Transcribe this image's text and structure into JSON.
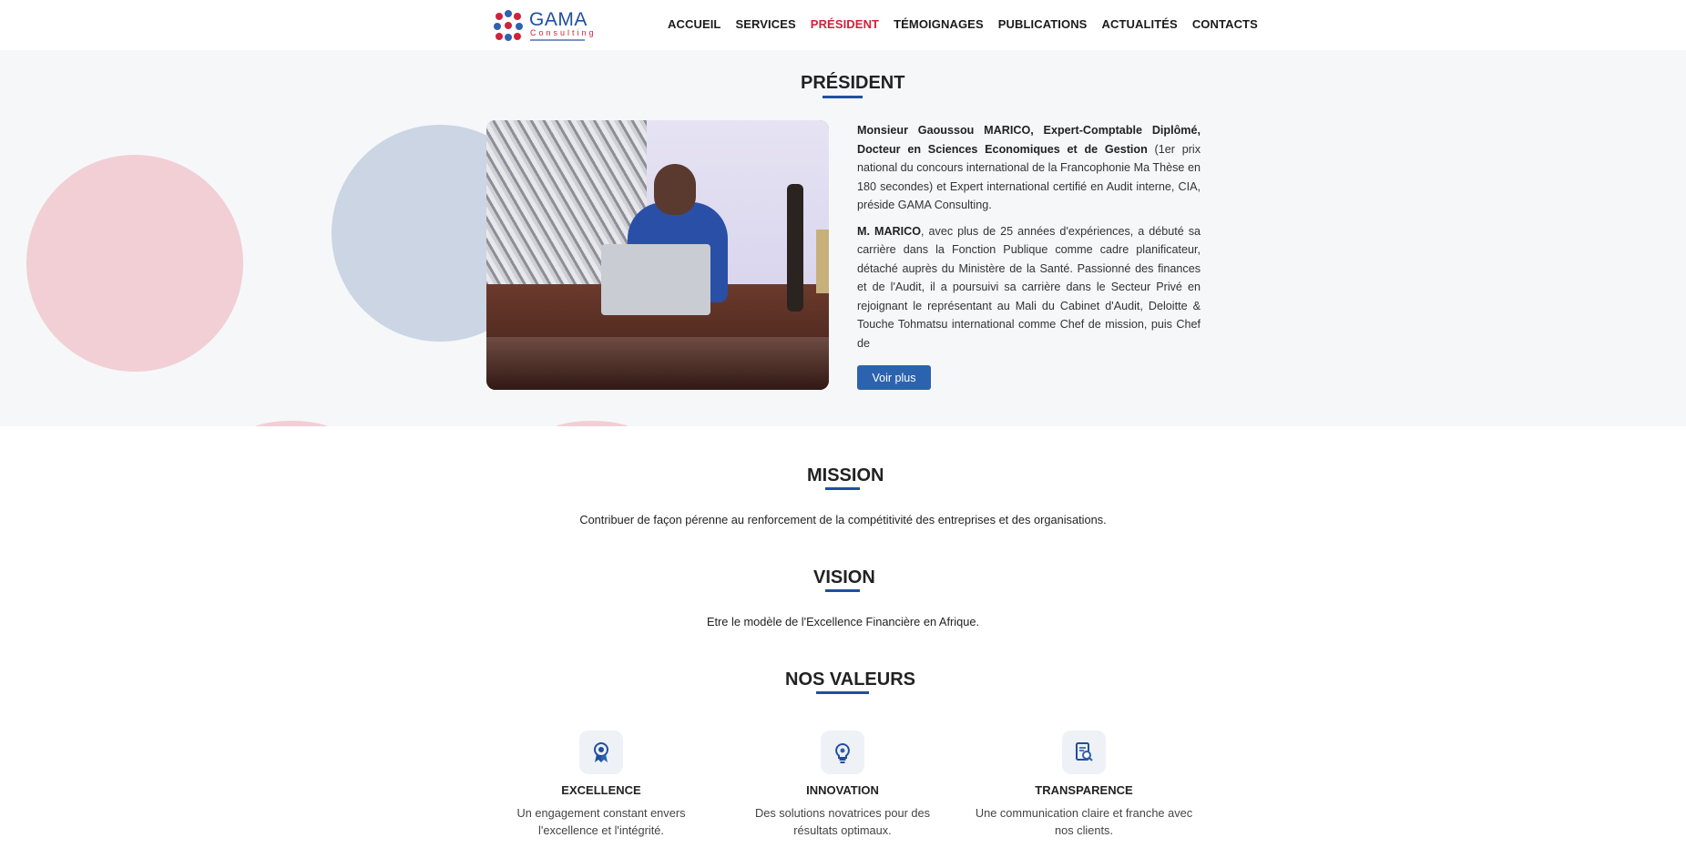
{
  "logo": {
    "brand": "GAMA",
    "sub": "Consulting"
  },
  "nav": {
    "items": [
      "ACCUEIL",
      "SERVICES",
      "PRÉSIDENT",
      "TÉMOIGNAGES",
      "PUBLICATIONS",
      "ACTUALITÉS",
      "CONTACTS"
    ],
    "active": "PRÉSIDENT"
  },
  "president": {
    "title": "PRÉSIDENT",
    "para1_bold": "Monsieur Gaoussou MARICO, Expert-Comptable Diplômé, Docteur en Sciences Economiques et de Gestion",
    "para1_rest": " (1er prix national du concours international de la Francophonie Ma Thèse en 180 secondes) et Expert international certifié en Audit interne, CIA, préside GAMA Consulting.",
    "para2_bold": "M. MARICO",
    "para2_rest": ", avec plus de 25 années d'expériences, a débuté sa carrière dans la Fonction Publique comme cadre planificateur, détaché auprès du Ministère de la Santé. Passionné des finances et de l'Audit, il a poursuivi sa carrière dans le Secteur Privé en rejoignant le représentant au Mali du Cabinet d'Audit, Deloitte & Touche Tohmatsu international comme Chef de mission, puis Chef de",
    "button": "Voir plus"
  },
  "mission": {
    "title": "MISSION",
    "text": "Contribuer de façon pérenne au renforcement de la compétitivité des entreprises et des organisations."
  },
  "vision": {
    "title": "VISION",
    "text": "Etre le modèle de l'Excellence Financière en Afrique."
  },
  "values": {
    "title": "NOS VALEURS",
    "items": [
      {
        "icon": "award-icon",
        "title": "EXCELLENCE",
        "desc": "Un engagement constant envers l'excellence et l'intégrité."
      },
      {
        "icon": "lightbulb-icon",
        "title": "INNOVATION",
        "desc": "Des solutions novatrices pour des résultats optimaux."
      },
      {
        "icon": "document-search-icon",
        "title": "TRANSPARENCE",
        "desc": "Une communication claire et franche avec nos clients."
      }
    ]
  },
  "colors": {
    "accent": "#d0223a",
    "primary": "#1f4fa0",
    "button": "#2c63ae"
  }
}
